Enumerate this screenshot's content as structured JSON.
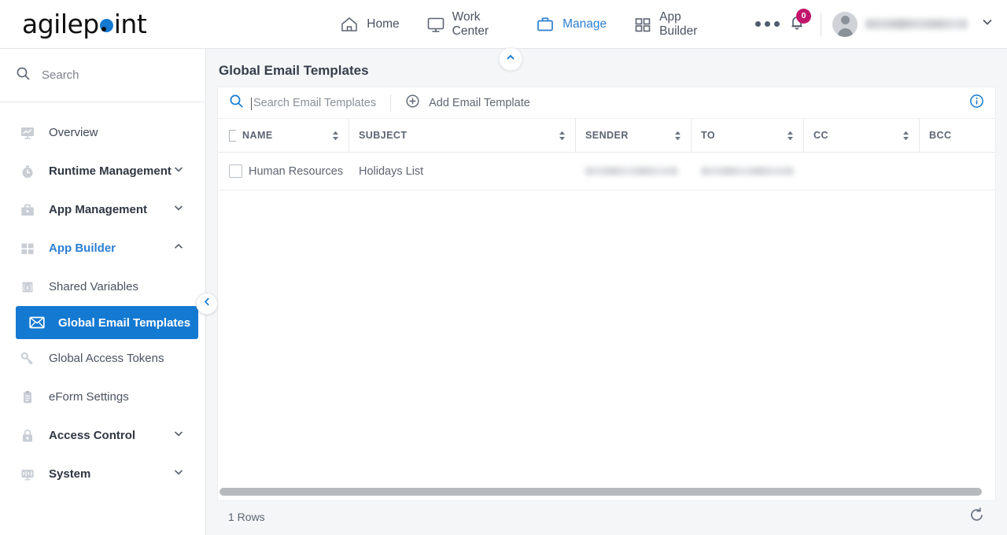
{
  "brand": {
    "logo_text_1": "agilep",
    "logo_text_2": "int",
    "accent_color": "#1479d1",
    "badge_color": "#c2156c"
  },
  "topnav": {
    "items": [
      {
        "label": "Home",
        "icon": "home-icon",
        "active": false
      },
      {
        "label": "Work Center",
        "icon": "monitor-icon",
        "active": false
      },
      {
        "label": "Manage",
        "icon": "briefcase-icon",
        "active": true
      },
      {
        "label": "App Builder",
        "icon": "grid-icon",
        "active": false
      }
    ],
    "overflow_label": "...",
    "notification_count": "0",
    "username": ""
  },
  "sidebar": {
    "search_placeholder": "Search",
    "items": [
      {
        "label": "Overview",
        "icon": "chart-monitor-icon",
        "expandable": false,
        "state": "normal"
      },
      {
        "label": "Runtime Management",
        "icon": "stopwatch-icon",
        "expandable": true,
        "state": "collapsed"
      },
      {
        "label": "App Management",
        "icon": "briefcase-icon",
        "expandable": true,
        "state": "collapsed"
      },
      {
        "label": "App Builder",
        "icon": "grid-icon",
        "expandable": true,
        "state": "expanded"
      }
    ],
    "sub_items": [
      {
        "label": "Shared Variables",
        "icon": "variable-icon",
        "selected": false
      },
      {
        "label": "Global Email Templates",
        "icon": "envelope-icon",
        "selected": true
      },
      {
        "label": "Global Access Tokens",
        "icon": "key-icon",
        "selected": false
      },
      {
        "label": "eForm Settings",
        "icon": "clipboard-icon",
        "selected": false
      }
    ],
    "items_after": [
      {
        "label": "Access Control",
        "icon": "lock-icon",
        "expandable": true,
        "state": "collapsed"
      },
      {
        "label": "System",
        "icon": "system-monitor-icon",
        "expandable": true,
        "state": "collapsed"
      }
    ],
    "collapse_icon": "chevron-left-icon"
  },
  "page": {
    "title": "Global Email Templates",
    "header_collapse_icon": "chevron-up-icon"
  },
  "toolbar": {
    "search_placeholder": "Search Email Templates",
    "search_value": "",
    "add_label": "Add Email Template",
    "add_icon": "plus-circle-icon",
    "info_icon": "info-icon"
  },
  "grid": {
    "columns": [
      {
        "label": "NAME",
        "sortable": true
      },
      {
        "label": "SUBJECT",
        "sortable": true
      },
      {
        "label": "SENDER",
        "sortable": true
      },
      {
        "label": "TO",
        "sortable": true
      },
      {
        "label": "CC",
        "sortable": true
      },
      {
        "label": "BCC",
        "sortable": false
      }
    ],
    "rows": [
      {
        "name": "Human Resources",
        "subject": "Holidays List",
        "sender": "",
        "to": "",
        "cc": "",
        "bcc": ""
      }
    ]
  },
  "footer": {
    "rows_label": "1 Rows",
    "refresh_icon": "refresh-icon"
  }
}
